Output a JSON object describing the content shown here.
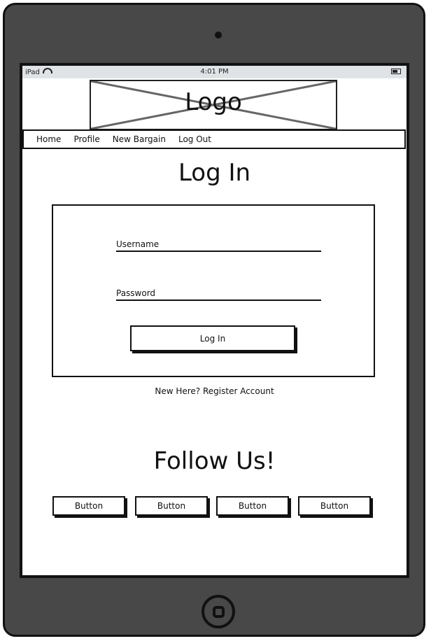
{
  "statusbar": {
    "device": "iPad",
    "time": "4:01 PM"
  },
  "logo": {
    "label": "Logo"
  },
  "nav": {
    "items": [
      "Home",
      "Profile",
      "New Bargain",
      "Log Out"
    ]
  },
  "page": {
    "title": "Log In"
  },
  "form": {
    "username_label": "Username",
    "password_label": "Password",
    "submit_label": "Log In"
  },
  "register": {
    "text": "New Here? Register Account"
  },
  "follow": {
    "title": "Follow Us!",
    "buttons": [
      "Button",
      "Button",
      "Button",
      "Button"
    ]
  },
  "colors": {
    "device_body": "#484848",
    "statusbar": "#dfe3e6",
    "ink": "#111111"
  }
}
